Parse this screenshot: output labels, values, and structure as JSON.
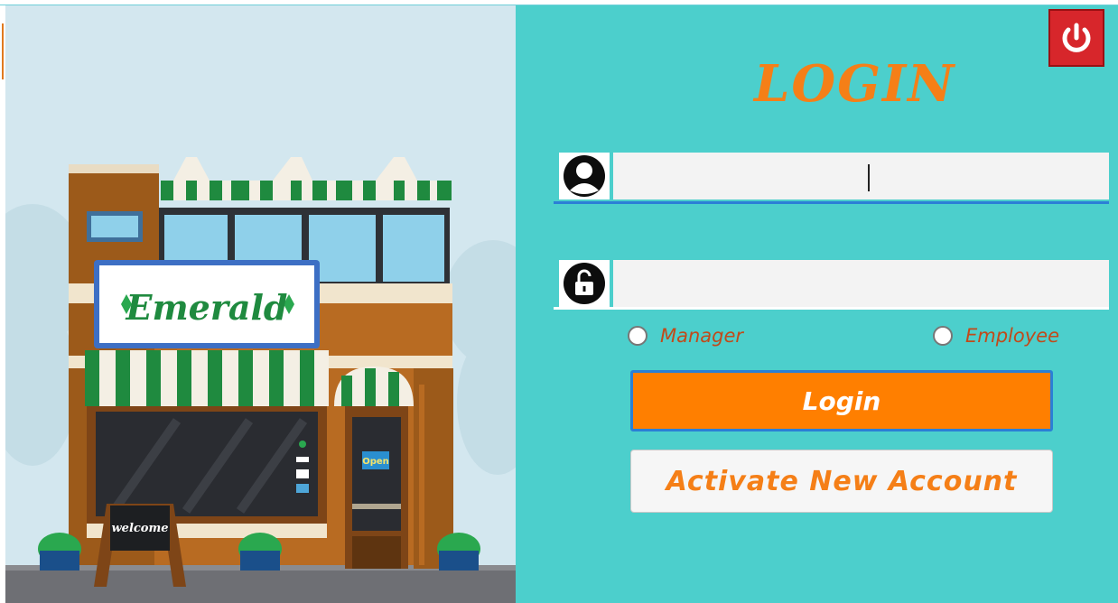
{
  "brand": {
    "shop_sign": "Emerald",
    "chalkboard": "welcome",
    "door_sign": "Open"
  },
  "login": {
    "title": "LOGIN",
    "username": {
      "value": "",
      "placeholder": ""
    },
    "password": {
      "value": "",
      "placeholder": ""
    },
    "roles": [
      {
        "label": "Manager",
        "selected": false
      },
      {
        "label": "Employee",
        "selected": false
      }
    ],
    "login_button": "Login",
    "activate_button": "Activate New Account"
  },
  "colors": {
    "panel_bg": "#4ccfcc",
    "title": "#f57f17",
    "login_button_bg": "#ff7f00",
    "login_button_border": "#2b7fd6",
    "power_button": "#d7262b",
    "radio_label": "#c14a1a"
  },
  "icons": {
    "power": "power-icon",
    "user": "user-icon",
    "lock": "unlock-icon"
  }
}
